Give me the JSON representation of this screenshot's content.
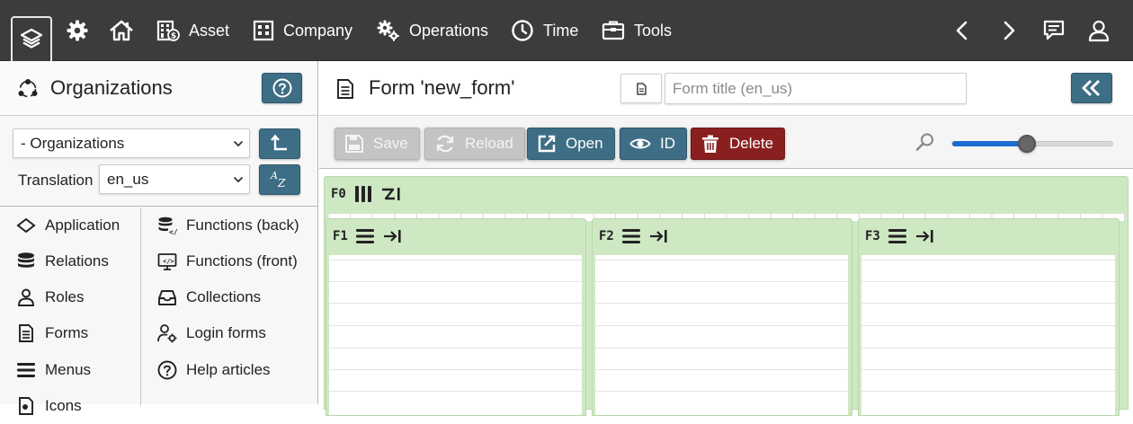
{
  "topbar": {
    "nav": [
      {
        "label": "",
        "icon": "layers-icon"
      },
      {
        "label": "",
        "icon": "gear-icon"
      },
      {
        "label": "",
        "icon": "home-icon"
      },
      {
        "label": "Asset",
        "icon": "building-dollar-icon"
      },
      {
        "label": "Company",
        "icon": "building-icon"
      },
      {
        "label": "Operations",
        "icon": "gears-icon"
      },
      {
        "label": "Time",
        "icon": "clock-icon"
      },
      {
        "label": "Tools",
        "icon": "toolbox-icon"
      }
    ],
    "right_icons": [
      "chevron-left-icon",
      "chevron-right-icon",
      "chat-icon",
      "user-icon"
    ]
  },
  "sidebar": {
    "title": "Organizations",
    "module_select": {
      "value": "- Organizations"
    },
    "translation": {
      "label": "Translation",
      "value": "en_us"
    },
    "nav_left": [
      {
        "label": "Application",
        "icon": "diamond-icon"
      },
      {
        "label": "Relations",
        "icon": "database-icon"
      },
      {
        "label": "Roles",
        "icon": "users-icon"
      },
      {
        "label": "Forms",
        "icon": "document-icon"
      },
      {
        "label": "Menus",
        "icon": "menu-icon"
      },
      {
        "label": "Icons",
        "icon": "icons-icon"
      }
    ],
    "nav_right": [
      {
        "label": "Functions (back)",
        "icon": "db-code-icon"
      },
      {
        "label": "Functions (front)",
        "icon": "monitor-code-icon"
      },
      {
        "label": "Collections",
        "icon": "inbox-icon"
      },
      {
        "label": "Login forms",
        "icon": "user-gear-icon"
      },
      {
        "label": "Help articles",
        "icon": "help-icon"
      }
    ]
  },
  "main": {
    "form_title": "Form 'new_form'",
    "title_input": {
      "placeholder": "Form title (en_us)",
      "value": ""
    },
    "toolbar": {
      "save": "Save",
      "reload": "Reload",
      "open": "Open",
      "id": "ID",
      "delete": "Delete"
    },
    "zoom": {
      "value_fraction": 0.46
    },
    "builder": {
      "root": {
        "label": "F0"
      },
      "fields": [
        {
          "label": "F1"
        },
        {
          "label": "F2"
        },
        {
          "label": "F3"
        }
      ]
    }
  },
  "colors": {
    "topbar": "#3c3c3c",
    "accent": "#3e6e85",
    "danger": "#8a1f1f",
    "field_bg": "#cfe8c4",
    "slider": "#1c6ccf"
  }
}
